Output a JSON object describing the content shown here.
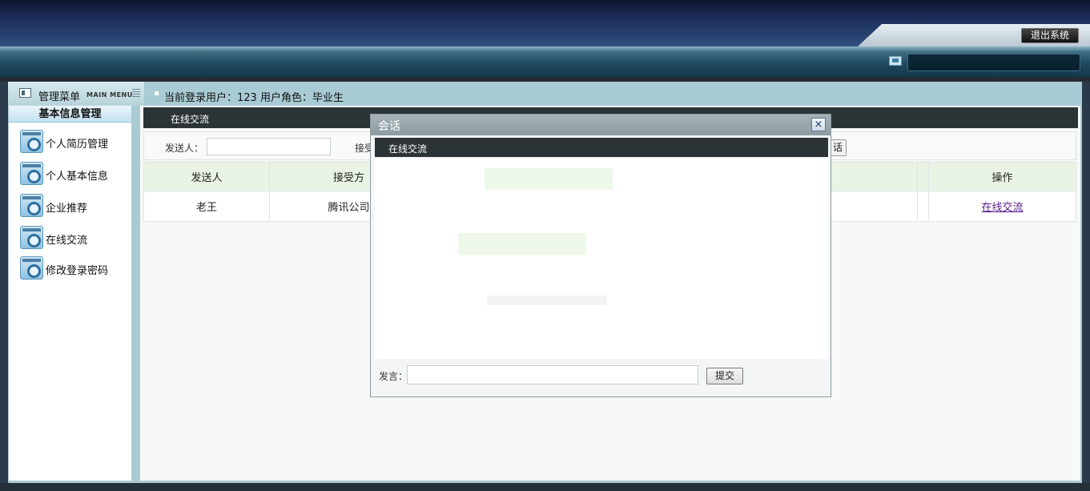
{
  "header": {
    "logout_label": "退出系统"
  },
  "menu": {
    "title": "管理菜单",
    "subtitle": "MAIN MENU",
    "group_label": "基本信息管理",
    "items": [
      {
        "label": "个人简历管理"
      },
      {
        "label": "个人基本信息"
      },
      {
        "label": "企业推荐"
      },
      {
        "label": "在线交流"
      },
      {
        "label": "修改登录密码"
      }
    ]
  },
  "user_bar": {
    "text": "当前登录用户：123  用户角色：毕业生"
  },
  "content": {
    "section_title": "在线交流",
    "search": {
      "sender_label": "发送人：",
      "sender_value": "",
      "receiver_label": "接受",
      "button_label": "话"
    },
    "table": {
      "headers": [
        "发送人",
        "接受方",
        "操作"
      ],
      "rows": [
        {
          "sender": "老王",
          "receiver": "腾讯公司",
          "action": "在线交流"
        }
      ]
    }
  },
  "dialog": {
    "title": "会话",
    "close_label": "×",
    "bar_title": "在线交流",
    "speak_label": "发言：",
    "speak_value": "",
    "submit_label": "提交"
  }
}
